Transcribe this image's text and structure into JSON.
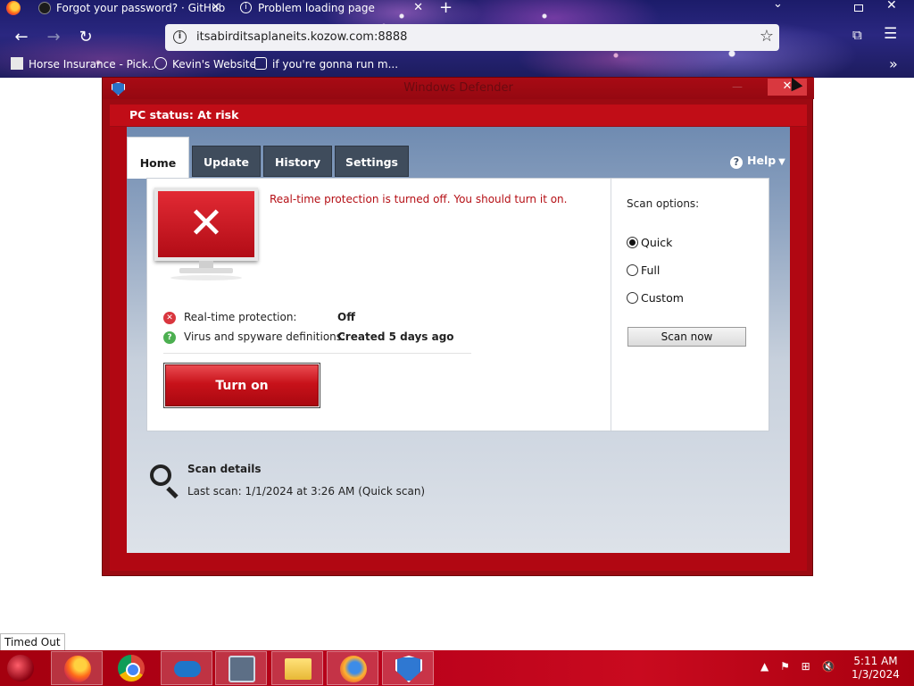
{
  "browser": {
    "tabs": [
      {
        "title": "Forgot your password? · GitHub",
        "close": "✕"
      },
      {
        "title": "Problem loading page",
        "close": "✕"
      }
    ],
    "new_tab": "+",
    "url": "itsabirditsaplaneits.kozow.com:8888",
    "bookmarks": [
      {
        "label": "Horse Insurance - Pick..."
      },
      {
        "label": "Kevin's Website"
      },
      {
        "label": "if you're gonna run m..."
      }
    ]
  },
  "defender": {
    "window_title": "Windows Defender",
    "status": "PC status: At risk",
    "tabs": [
      "Home",
      "Update",
      "History",
      "Settings"
    ],
    "active_tab": "Home",
    "help": "Help",
    "alert": "Real-time protection is turned off. You should turn it on.",
    "rows": [
      {
        "label": "Real-time protection:",
        "value": "Off"
      },
      {
        "label": "Virus and spyware definitions:",
        "value": "Created 5 days ago"
      }
    ],
    "turn_on": "Turn on",
    "scan_options_label": "Scan options:",
    "scan_options": [
      {
        "label": "Quick",
        "checked": true
      },
      {
        "label": "Full",
        "checked": false
      },
      {
        "label": "Custom",
        "checked": false
      }
    ],
    "scan_now": "Scan now",
    "scan_details_title": "Scan details",
    "last_scan": "Last scan:  1/1/2024 at 3:26 AM (Quick scan)"
  },
  "status_tooltip": "Timed Out",
  "taskbar": {
    "items": [
      "firefox-icon",
      "chrome-icon",
      "onedrive-icon",
      "control-panel-icon",
      "file-explorer-icon",
      "firefox-alt-icon",
      "defender-shield-icon"
    ],
    "time": "5:11 AM",
    "date": "1/3/2024"
  },
  "colors": {
    "defender_red": "#b10712",
    "status_red": "#c10d17",
    "alert_text": "#b50f15",
    "taskbar_red": "#b8001a",
    "browser_bg": "#2a2780"
  }
}
